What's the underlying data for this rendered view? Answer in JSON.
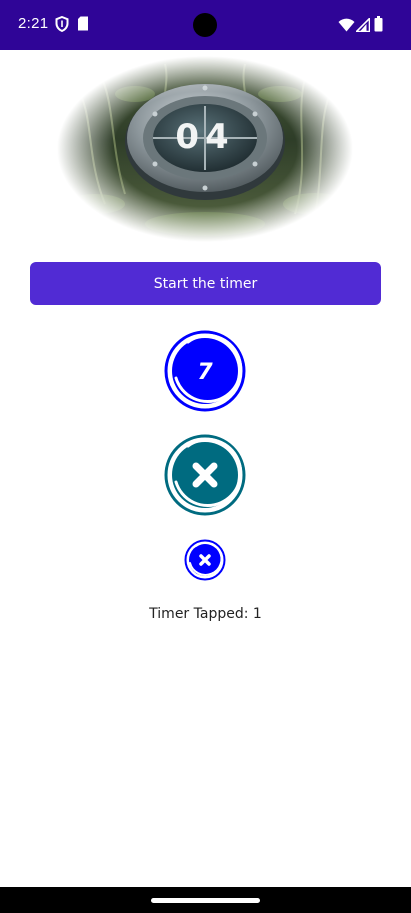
{
  "status_bar": {
    "time": "2:21",
    "left_icons": [
      "shield-icon",
      "sd-card-icon"
    ],
    "right_icons": [
      "wifi-icon",
      "signal-icon",
      "battery-icon"
    ],
    "background": "#2f0597"
  },
  "hero": {
    "counter_digits": "04",
    "image": "timer-dial-jungle-image"
  },
  "start_button": {
    "label": "Start the timer",
    "color": "#512bd4"
  },
  "timers": [
    {
      "label": "7",
      "color": "#0000ff"
    },
    {
      "icon": "close-icon",
      "color": "#006b80"
    },
    {
      "icon": "close-icon",
      "color": "#0000ff"
    }
  ],
  "tapped": {
    "text": "Timer Tapped: 1"
  }
}
